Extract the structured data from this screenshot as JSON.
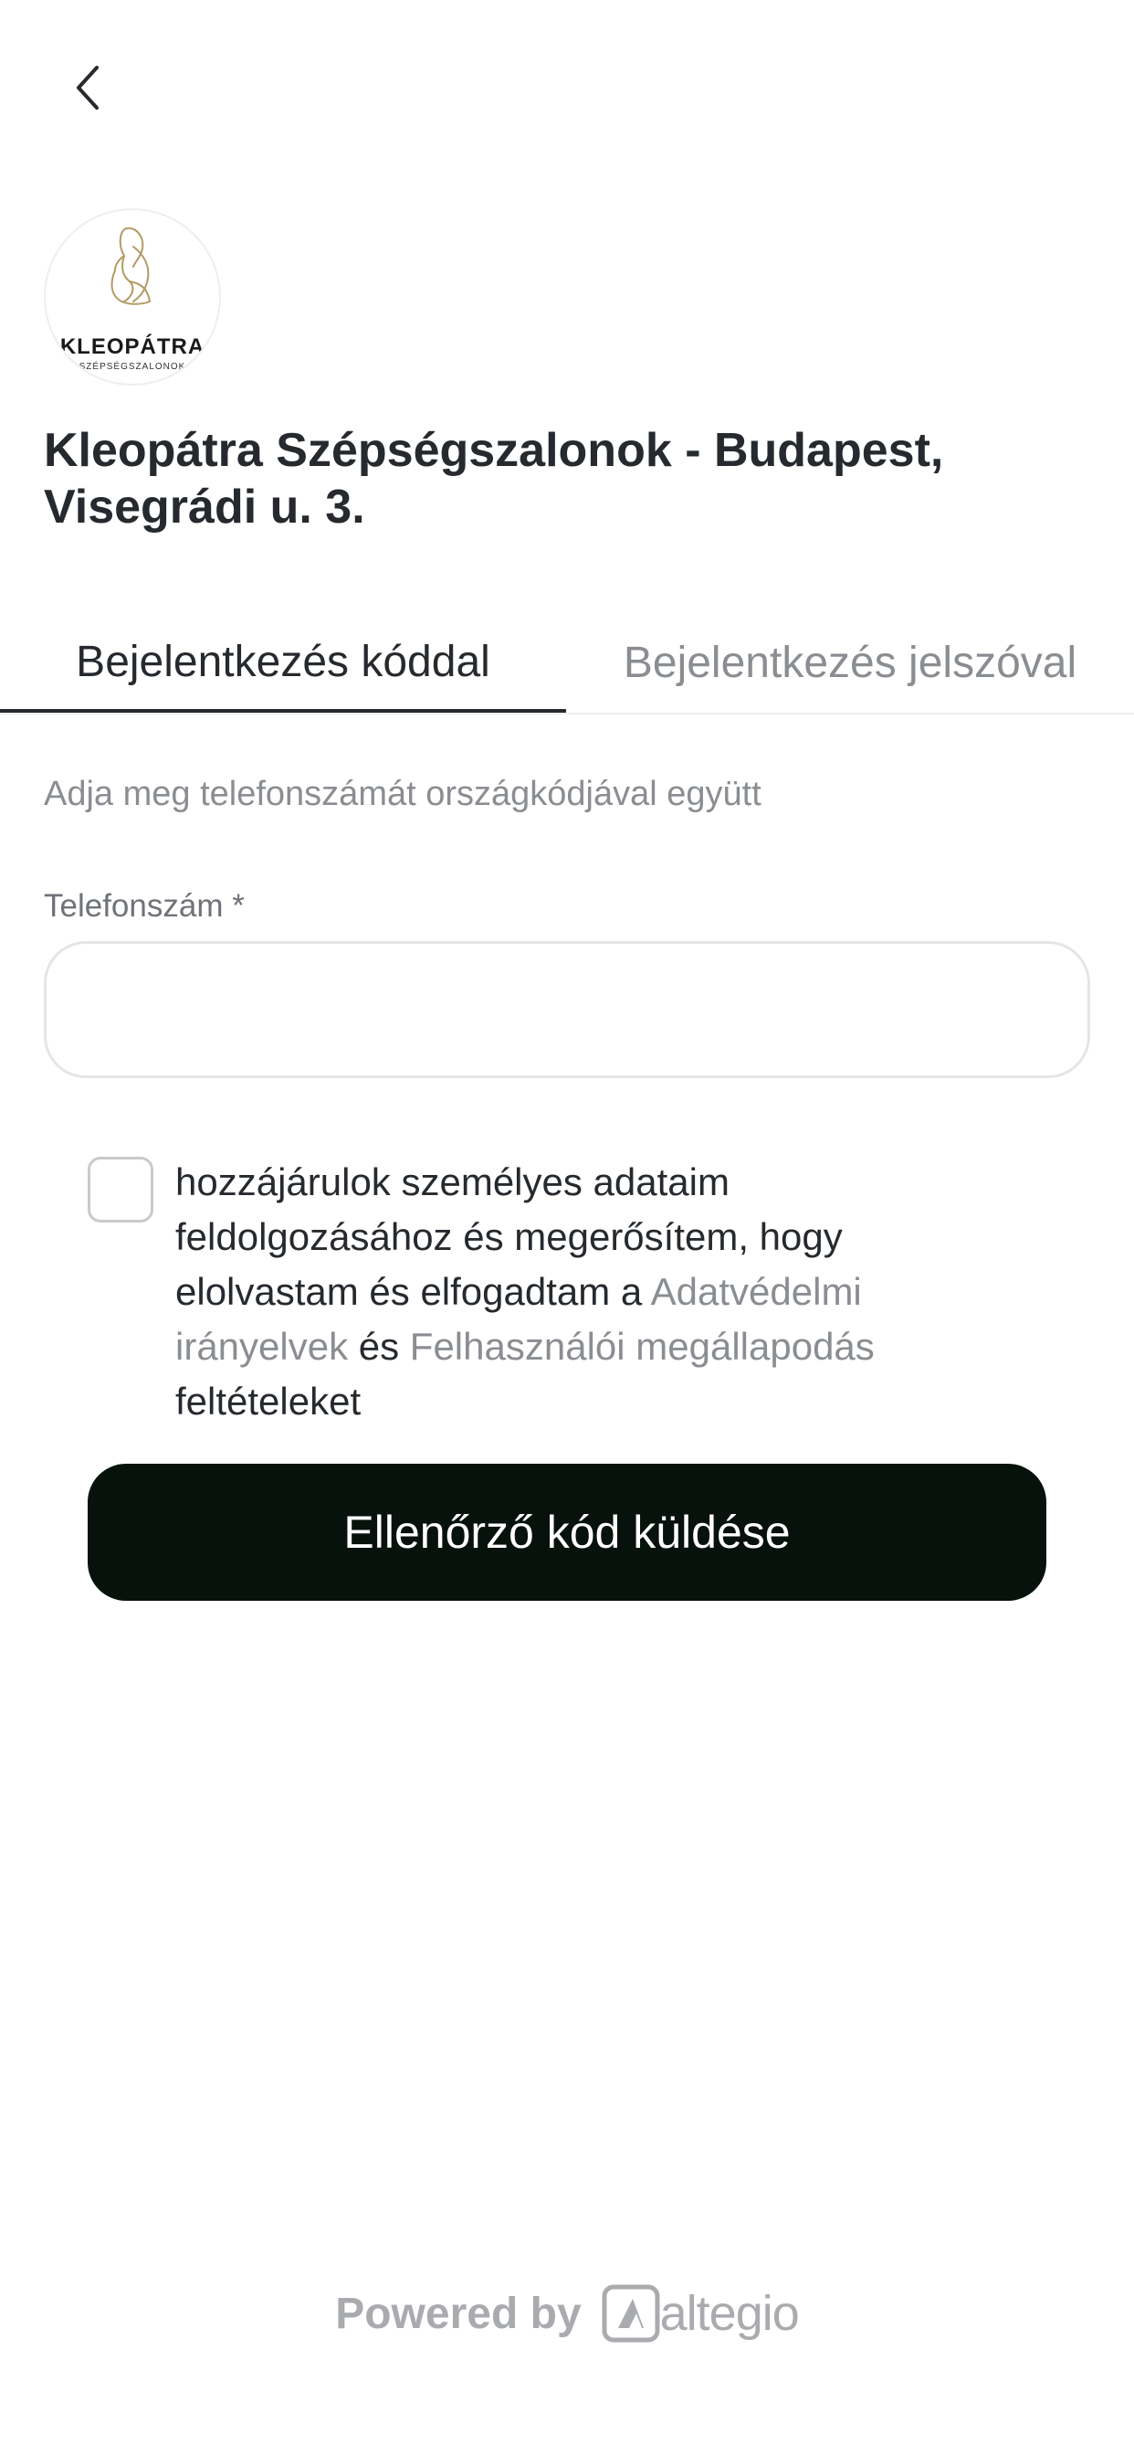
{
  "header": {
    "back_icon": "chevron-left-icon"
  },
  "salon": {
    "logo_brand": "KLEOPÁTRA",
    "logo_sub": "SZÉPSÉGSZALONOK",
    "title": "Kleopátra Szépségszalonok - Budapest, Visegrádi u. 3."
  },
  "tabs": [
    {
      "label": "Bejelentkezés kóddal",
      "active": true
    },
    {
      "label": "Bejelentkezés jelszóval",
      "active": false
    }
  ],
  "form": {
    "hint": "Adja meg telefonszámát országkódjával együtt",
    "phone_label": "Telefonszám *",
    "phone_value": "",
    "consent": {
      "checked": false,
      "text_before": "hozzájárulok személyes adataim feldolgozásához és megerősítem, hogy elolvastam és elfogadtam a ",
      "privacy_link": "Adatvédelmi irányelvek",
      "and": " és ",
      "terms_link": "Felhasználói megállapodás",
      "text_after": " feltételeket"
    },
    "submit_label": "Ellenőrző kód küldése"
  },
  "footer": {
    "powered_by": "Powered by",
    "brand": "altegio",
    "brand_icon": "altegio-logo-icon"
  },
  "colors": {
    "primary_button": "#08120d",
    "text": "#262a2e",
    "muted": "#8a8d91",
    "border": "#e4e5e7"
  }
}
